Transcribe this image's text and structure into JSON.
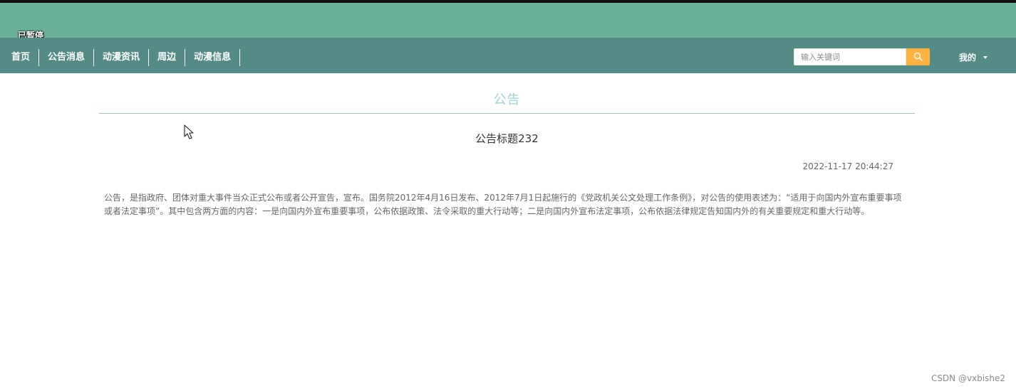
{
  "player": {
    "status_label": "已暂停"
  },
  "nav": {
    "items": [
      {
        "label": "首页"
      },
      {
        "label": "公告消息"
      },
      {
        "label": "动漫资讯"
      },
      {
        "label": "周边"
      },
      {
        "label": "动漫信息"
      }
    ]
  },
  "search": {
    "placeholder": "输入关键词",
    "value": ""
  },
  "user": {
    "menu_label": "我的"
  },
  "colors": {
    "header_band": "#6ab09a",
    "nav_bar": "#548b86",
    "search_button": "#fdb241",
    "section_title": "#9dd3d4"
  },
  "page": {
    "section_title": "公告",
    "notice": {
      "title": "公告标题232",
      "date": "2022-11-17 20:44:27",
      "body": "公告，是指政府、团体对重大事件当众正式公布或者公开宣告，宣布。国务院2012年4月16日发布、2012年7月1日起施行的《党政机关公文处理工作条例》，对公告的使用表述为：“适用于向国内外宣布重要事项或者法定事项”。其中包含两方面的内容：一是向国内外宣布重要事项，公布依据政策、法令采取的重大行动等；二是向国内外宣布法定事项，公布依据法律规定告知国内外的有关重要规定和重大行动等。"
    }
  },
  "watermark": "CSDN @vxbishe2"
}
